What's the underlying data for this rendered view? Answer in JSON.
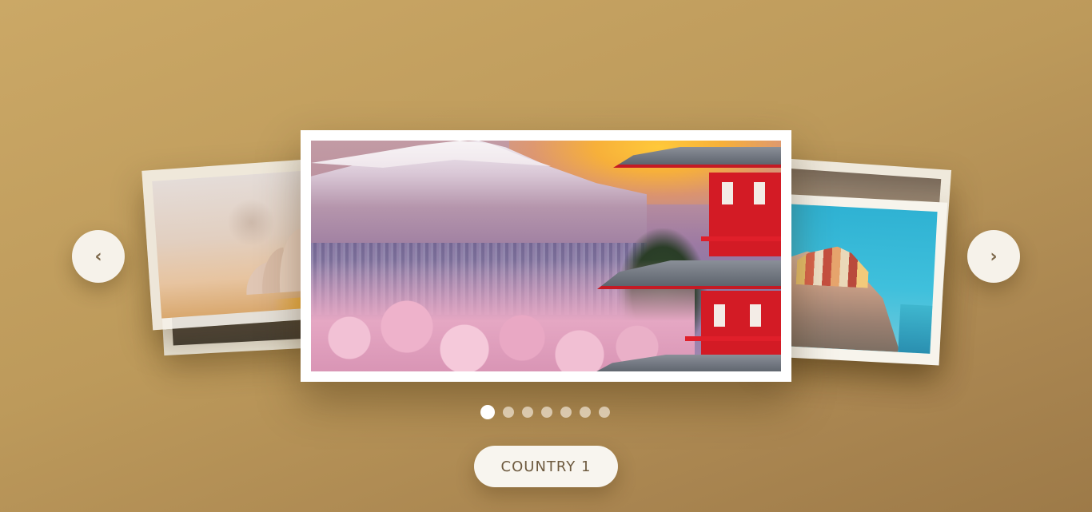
{
  "carousel": {
    "prev_icon": "chevron-left-icon",
    "prev_glyph": "‹",
    "next_icon": "chevron-right-icon",
    "next_glyph": "›",
    "slide_count": 7,
    "active_index": 0,
    "label": "COUNTRY 1"
  },
  "colors": {
    "background_start": "#cba866",
    "background_end": "#9d7a48",
    "button_bg": "#f6f2ea",
    "button_text": "#6e5a3f",
    "dot_active": "#ffffff",
    "dot_inactive": "#ece0cd"
  }
}
